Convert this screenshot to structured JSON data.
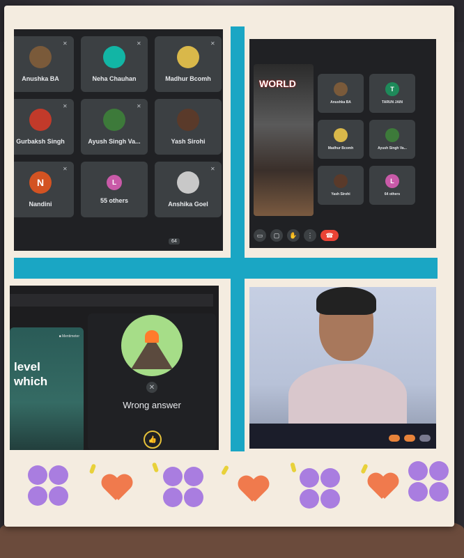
{
  "panel1": {
    "tiles": [
      {
        "name": "Anushka BA",
        "initial": "",
        "color": "#7a5a3a"
      },
      {
        "name": "Neha Chauhan",
        "initial": "",
        "color": "#12b5a5"
      },
      {
        "name": "Madhur Bcomh",
        "initial": "",
        "color": "#d9b84a"
      },
      {
        "name": "Gurbaksh Singh",
        "initial": "",
        "color": "#c23a2a"
      },
      {
        "name": "Ayush Singh Va...",
        "initial": "",
        "color": "#3d7a3a"
      },
      {
        "name": "Yash Sirohi",
        "initial": "",
        "color": "#5a3a2a"
      },
      {
        "name": "Nandini",
        "initial": "N",
        "color": "#d35322"
      },
      {
        "name": "55 others",
        "initial": "L",
        "color": "#c95aa8"
      },
      {
        "name": "Anshika Goel",
        "initial": "",
        "color": "#c8c8c8"
      }
    ],
    "count_badge": "64"
  },
  "panel2": {
    "video_logo": "WORLD",
    "tiles": [
      {
        "name": "Anushka BA",
        "initial": "",
        "color": "#7a5a3a"
      },
      {
        "name": "TARUN JAIN",
        "initial": "T",
        "color": "#1e8a5a"
      },
      {
        "name": "Madhur Bcomh",
        "initial": "",
        "color": "#d9b84a"
      },
      {
        "name": "Ayush Singh Va...",
        "initial": "",
        "color": "#3d7a3a"
      },
      {
        "name": "Yash Sirohi",
        "initial": "",
        "color": "#5a3a2a"
      },
      {
        "name": "64 others",
        "initial": "L",
        "color": "#c95aa8"
      }
    ]
  },
  "panel3": {
    "slide_text_1": "level",
    "slide_text_2": "which",
    "brand": "■ Mentimeter",
    "quiz_result": "Wrong answer"
  },
  "colors": {
    "accent_teal": "#1aa6c4",
    "frame": "#f4ece0",
    "flower": "#a97de0",
    "heart": "#f07a4d"
  }
}
